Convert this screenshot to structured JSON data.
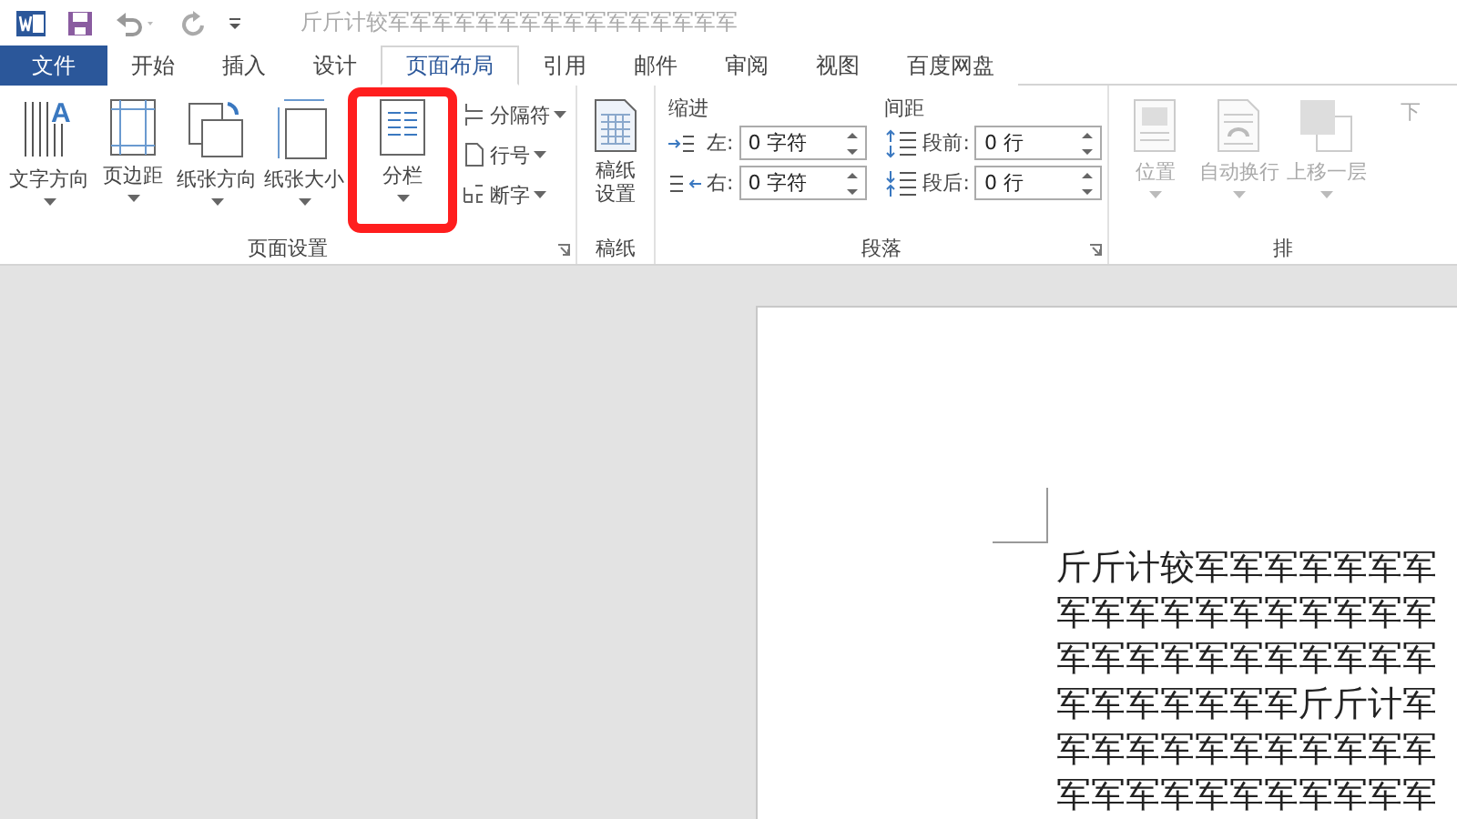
{
  "window": {
    "title": "斤斤计较军军军军军军军军军军军军军军军军"
  },
  "tabs": [
    {
      "label": "文件",
      "kind": "file",
      "selected": false
    },
    {
      "label": "开始",
      "kind": "tab",
      "selected": false
    },
    {
      "label": "插入",
      "kind": "tab",
      "selected": false
    },
    {
      "label": "设计",
      "kind": "tab",
      "selected": false
    },
    {
      "label": "页面布局",
      "kind": "tab",
      "selected": true
    },
    {
      "label": "引用",
      "kind": "tab",
      "selected": false
    },
    {
      "label": "邮件",
      "kind": "tab",
      "selected": false
    },
    {
      "label": "审阅",
      "kind": "tab",
      "selected": false
    },
    {
      "label": "视图",
      "kind": "tab",
      "selected": false
    },
    {
      "label": "百度网盘",
      "kind": "tab",
      "selected": false
    }
  ],
  "page_setup": {
    "label": "页面设置",
    "big_buttons": [
      {
        "label": "文字方向",
        "kind": "text-direction",
        "icon_glyph": "A",
        "highlighted": false
      },
      {
        "label": "页边距",
        "kind": "margins",
        "highlighted": false
      },
      {
        "label": "纸张方向",
        "kind": "orientation",
        "highlighted": false
      },
      {
        "label": "纸张大小",
        "kind": "size",
        "highlighted": false
      },
      {
        "label": "分栏",
        "kind": "columns",
        "highlighted": true
      }
    ],
    "small_buttons": [
      {
        "label": "分隔符",
        "kind": "breaks"
      },
      {
        "label": "行号",
        "kind": "line-numbers"
      },
      {
        "label": "断字",
        "kind": "hyphenation"
      }
    ]
  },
  "manuscript": {
    "label": "稿纸",
    "button": "稿纸设置"
  },
  "paragraph": {
    "label": "段落",
    "indent_label": "缩进",
    "spacing_label": "间距",
    "indent": [
      {
        "label": "左:",
        "value": "0 字符",
        "kind": "left"
      },
      {
        "label": "右:",
        "value": "0 字符",
        "kind": "right"
      }
    ],
    "spacing": [
      {
        "label": "段前:",
        "value": "0 行",
        "kind": "before"
      },
      {
        "label": "段后:",
        "value": "0 行",
        "kind": "after"
      }
    ]
  },
  "arrange": {
    "label": "排",
    "buttons": [
      {
        "label": "位置",
        "kind": "position",
        "disabled": true
      },
      {
        "label": "自动换行",
        "kind": "wrap",
        "disabled": true
      },
      {
        "label": "上移一层",
        "kind": "forward",
        "disabled": true
      },
      {
        "label": "下",
        "kind": "backward",
        "disabled": true
      }
    ]
  },
  "document": {
    "lines": [
      "斤斤计较军军军军军军军",
      "军军军军军军军军军军军",
      "军军军军军军军军军军军",
      "军军军军军军军斤斤计军",
      "军军军军军军军军军军军",
      "军军军军军军军军军军军"
    ]
  }
}
